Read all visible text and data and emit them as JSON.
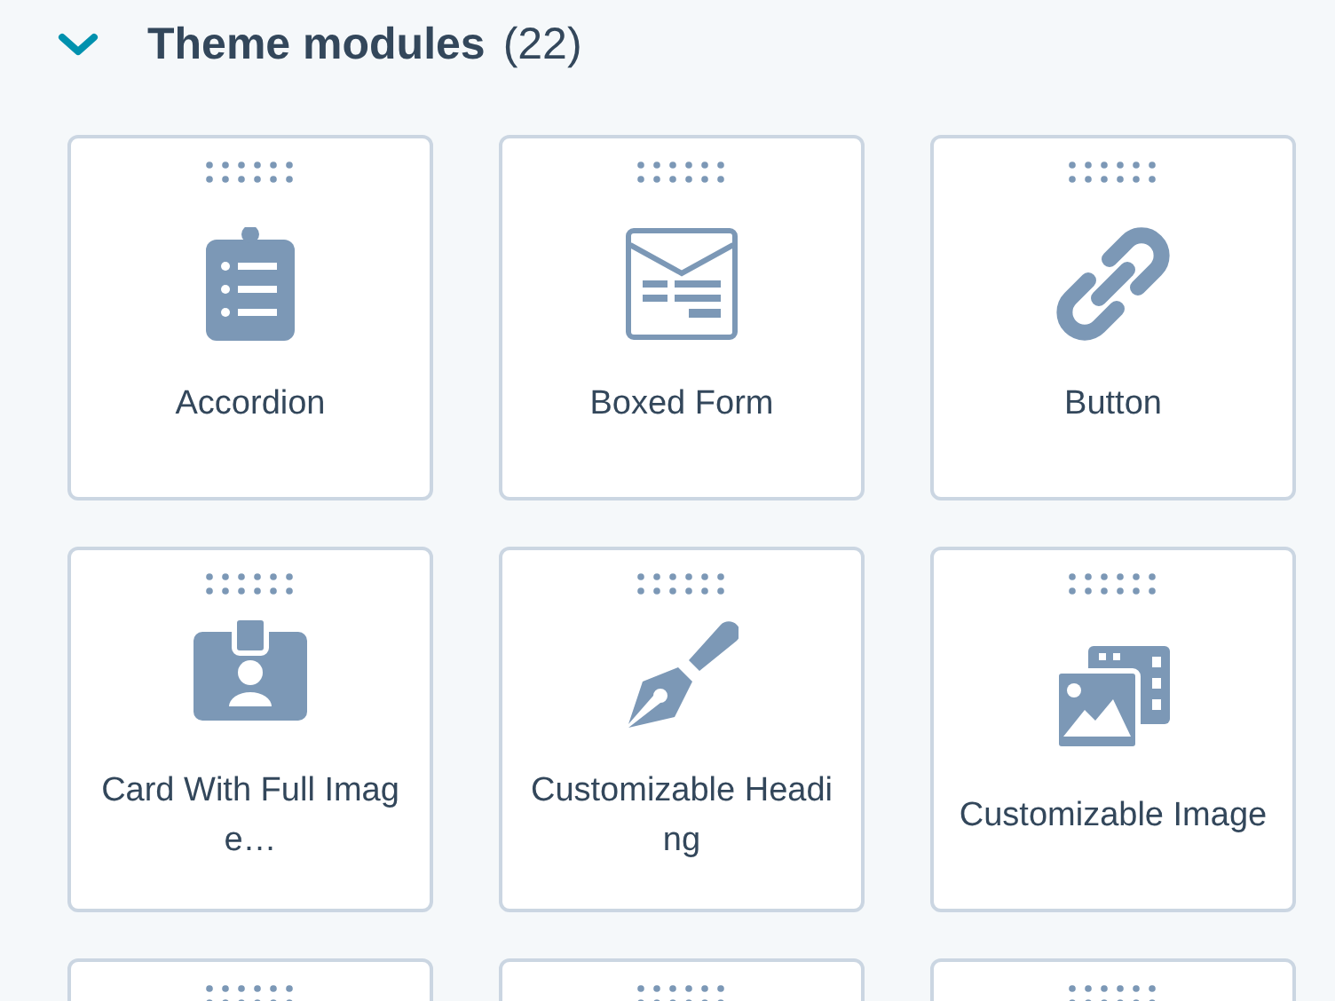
{
  "section": {
    "title": "Theme modules",
    "count": "(22)",
    "expanded": true
  },
  "modules": [
    {
      "kind": "clipboard",
      "label": "Accordion"
    },
    {
      "kind": "form",
      "label": "Boxed Form"
    },
    {
      "kind": "link",
      "label": "Button"
    },
    {
      "kind": "badge",
      "label": "Card With Full Image…"
    },
    {
      "kind": "pen",
      "label": "Customizable Heading"
    },
    {
      "kind": "images",
      "label": "Customizable Image"
    },
    {
      "kind": "hidden"
    },
    {
      "kind": "hidden"
    },
    {
      "kind": "hidden"
    }
  ]
}
